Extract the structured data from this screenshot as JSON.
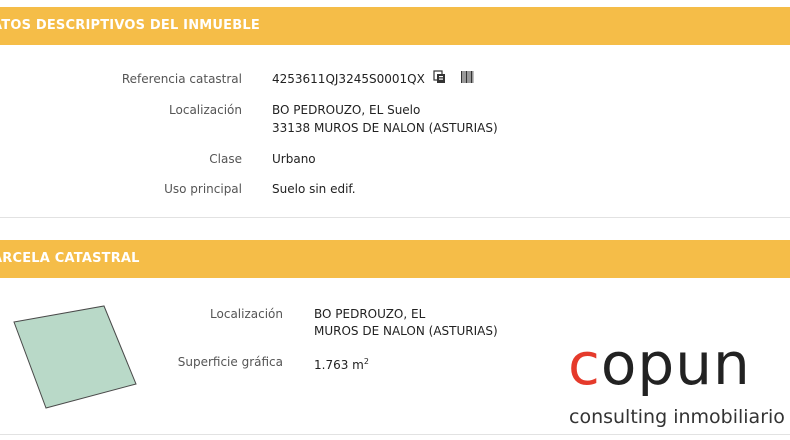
{
  "section1": {
    "title": "ATOS DESCRIPTIVOS DEL INMUEBLE",
    "rows": [
      {
        "label": "Referencia catastral",
        "value": "4253611QJ3245S0001QX"
      },
      {
        "label": "Localización",
        "value_line1": "BO PEDROUZO, EL Suelo",
        "value_line2": "33138 MUROS DE NALON (ASTURIAS)"
      },
      {
        "label": "Clase",
        "value": "Urbano"
      },
      {
        "label": "Uso principal",
        "value": "Suelo sin edif."
      }
    ],
    "icons": [
      "copy-icon",
      "barcode-icon"
    ]
  },
  "section2": {
    "title": "ARCELA CATASTRAL",
    "loc_label": "Localización",
    "loc_line1": "BO PEDROUZO, EL",
    "loc_line2": "MUROS DE NALON (ASTURIAS)",
    "area_label": "Superficie gráfica",
    "area_value": "1.763 m",
    "area_unit_sup": "2",
    "parcel_fill": "#b9d9c8",
    "parcel_stroke": "#4a4a4a"
  },
  "logo": {
    "word_first": "c",
    "word_rest": "opun",
    "tagline": "consulting inmobiliario",
    "accent": "#e53a2b"
  }
}
